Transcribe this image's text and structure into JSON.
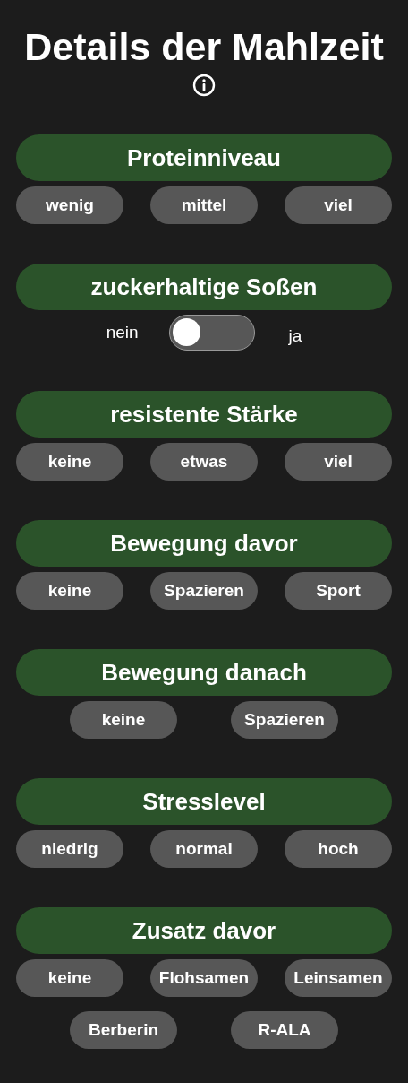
{
  "title": "Details der Mahlzeit",
  "sections": [
    {
      "kind": "choices",
      "heading": "Proteinniveau",
      "options": [
        {
          "label": "wenig",
          "selected": false
        },
        {
          "label": "mittel",
          "selected": false
        },
        {
          "label": "viel",
          "selected": false
        }
      ]
    },
    {
      "kind": "toggle",
      "heading": "zuckerhaltige Soßen",
      "off_label": "nein",
      "on_label": "ja",
      "on": false
    },
    {
      "kind": "choices",
      "heading": "resistente Stärke",
      "options": [
        {
          "label": "keine",
          "selected": false
        },
        {
          "label": "etwas",
          "selected": false
        },
        {
          "label": "viel",
          "selected": false
        }
      ]
    },
    {
      "kind": "choices",
      "heading": "Bewegung davor",
      "options": [
        {
          "label": "keine",
          "selected": false
        },
        {
          "label": "Spazieren",
          "selected": false
        },
        {
          "label": "Sport",
          "selected": false
        }
      ]
    },
    {
      "kind": "choices",
      "heading": "Bewegung danach",
      "options": [
        {
          "label": "keine",
          "selected": false
        },
        {
          "label": "Spazieren",
          "selected": false
        }
      ]
    },
    {
      "kind": "choices",
      "heading": "Stresslevel",
      "options": [
        {
          "label": "niedrig",
          "selected": false
        },
        {
          "label": "normal",
          "selected": false
        },
        {
          "label": "hoch",
          "selected": false
        }
      ]
    },
    {
      "kind": "choices",
      "heading": "Zusatz davor",
      "options": [
        {
          "label": "keine",
          "selected": false
        },
        {
          "label": "Flohsamen",
          "selected": false
        },
        {
          "label": "Leinsamen",
          "selected": false
        },
        {
          "label": "Berberin",
          "selected": false
        },
        {
          "label": "R-ALA",
          "selected": false
        }
      ]
    }
  ]
}
